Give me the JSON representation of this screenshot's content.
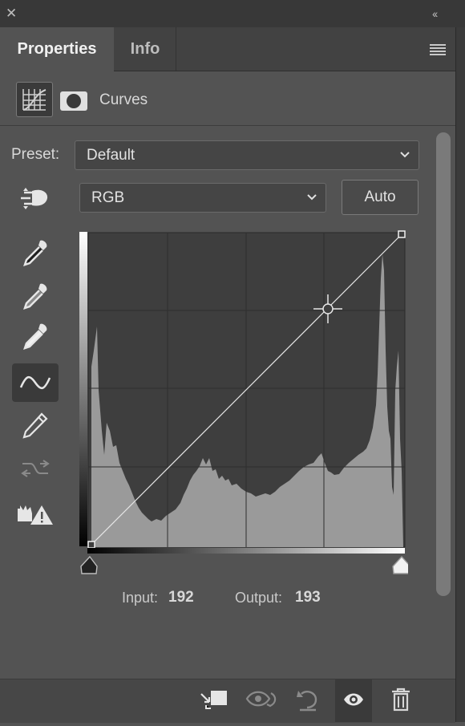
{
  "window": {
    "close_glyph": "✕",
    "collapse_glyph": "‹‹"
  },
  "tabs": [
    {
      "label": "Properties",
      "active": true
    },
    {
      "label": "Info",
      "active": false
    }
  ],
  "header": {
    "title": "Curves",
    "icons": [
      "curves-adjustment-icon",
      "layer-mask-icon"
    ]
  },
  "preset": {
    "label": "Preset:",
    "value": "Default"
  },
  "channel": {
    "value": "RGB"
  },
  "auto_button": {
    "label": "Auto"
  },
  "tools": [
    "targeted-adjustment-icon",
    "black-point-eyedropper-icon",
    "gray-point-eyedropper-icon",
    "white-point-eyedropper-icon",
    "curve-point-tool-icon",
    "pencil-tool-icon",
    "smooth-curve-icon",
    "clipping-warning-icon"
  ],
  "active_tool": "curve-point-tool-icon",
  "readout": {
    "input_label": "Input:",
    "input_value": "192",
    "output_label": "Output:",
    "output_value": "193"
  },
  "curve": {
    "points": [
      [
        0,
        0
      ],
      [
        192,
        193
      ],
      [
        255,
        255
      ]
    ],
    "range": [
      0,
      255
    ]
  },
  "bottom_icons": [
    "clip-to-layer-icon",
    "view-previous-state-icon",
    "reset-icon",
    "visibility-eye-icon",
    "trash-icon"
  ],
  "colors": {
    "panel": "#535353",
    "dark": "#383838",
    "histogram": "#9a9a9a",
    "graph_bg": "#3e3e3e"
  }
}
